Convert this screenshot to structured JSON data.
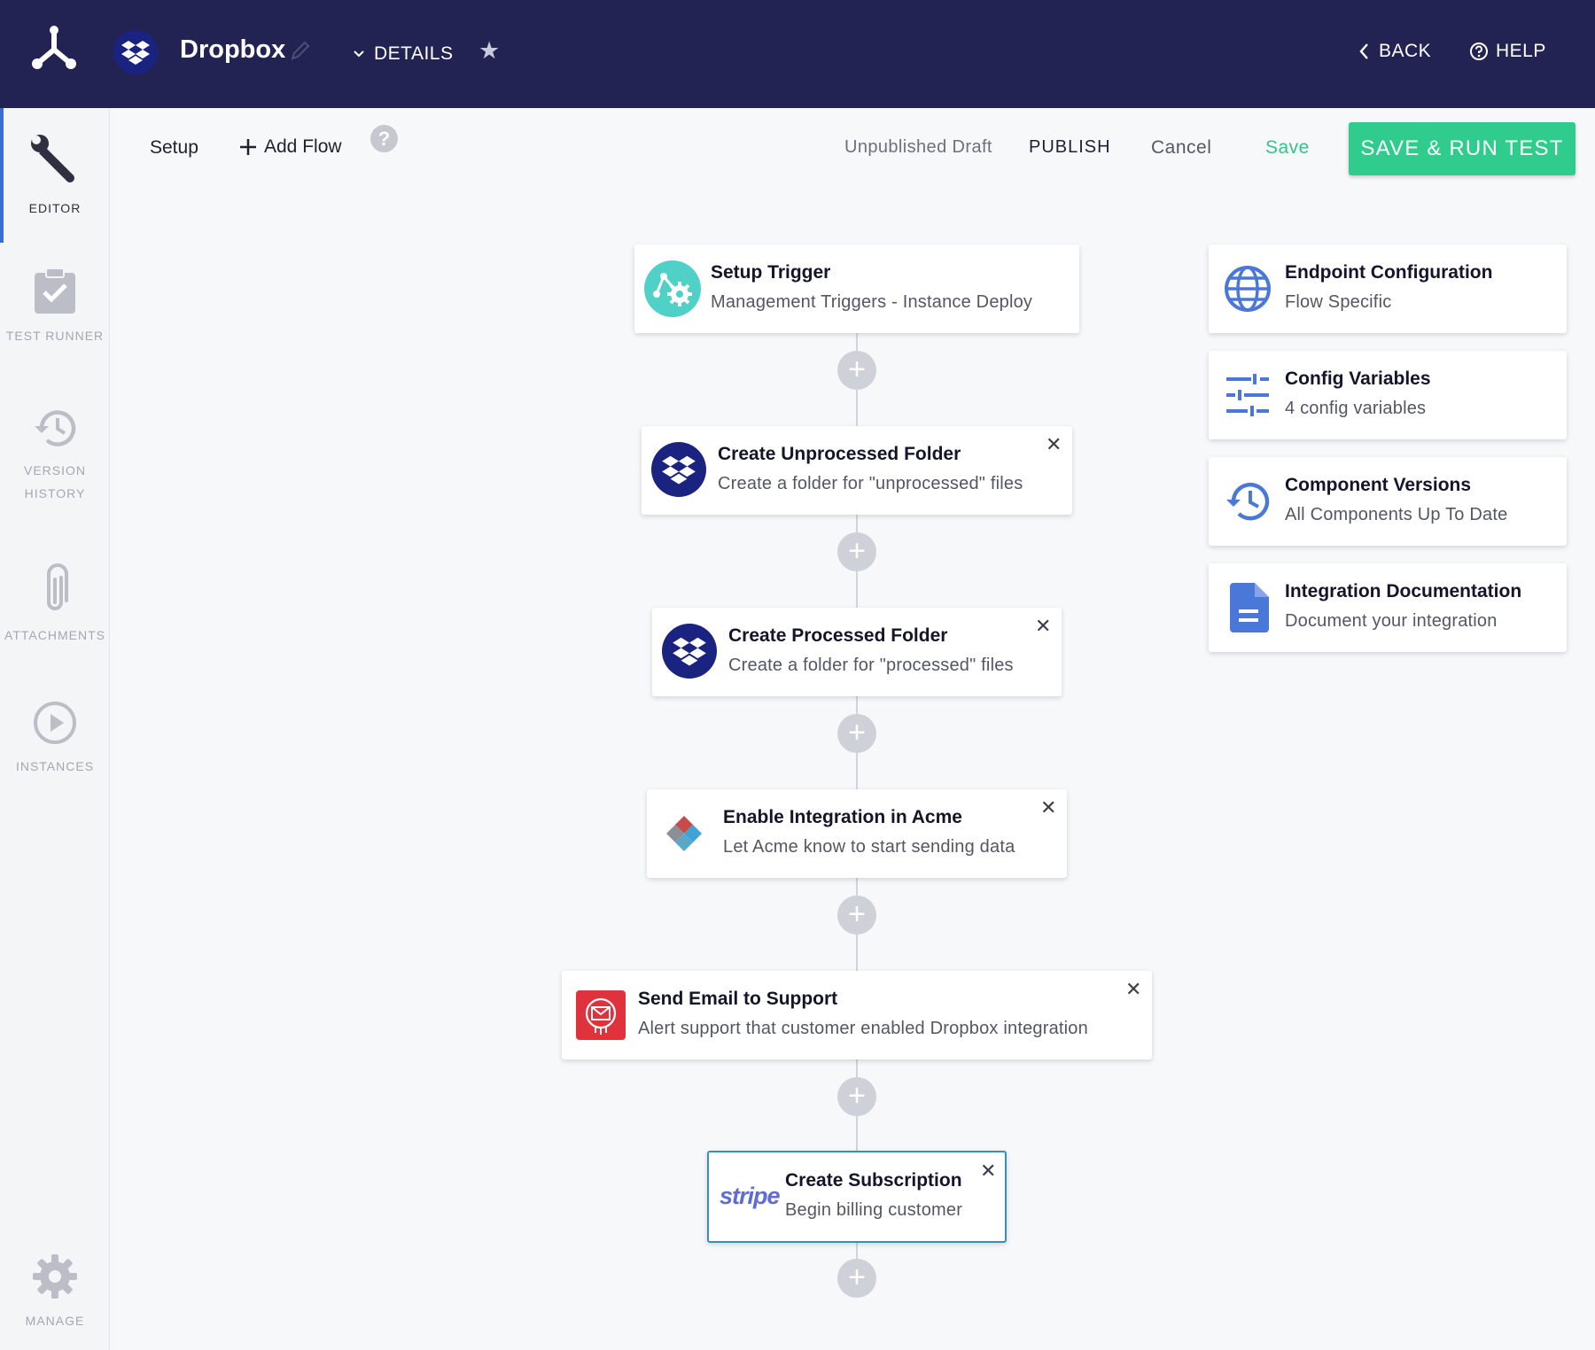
{
  "header": {
    "app_title": "Dropbox",
    "details_label": "DETAILS",
    "back_label": "BACK",
    "help_label": "HELP",
    "colors": {
      "bar": "#222353"
    }
  },
  "sidebar": {
    "items": [
      {
        "label": "EDITOR",
        "icon": "wrench-icon",
        "active": true
      },
      {
        "label": "TEST RUNNER",
        "icon": "clipboard-check-icon"
      },
      {
        "label_line1": "VERSION",
        "label_line2": "HISTORY",
        "icon": "history-icon"
      },
      {
        "label": "ATTACHMENTS",
        "icon": "paperclip-icon"
      },
      {
        "label": "INSTANCES",
        "icon": "play-circle-icon"
      },
      {
        "label": "MANAGE",
        "icon": "gear-icon"
      }
    ]
  },
  "toolbar": {
    "setup_label": "Setup",
    "add_flow_label": "Add Flow",
    "help_glyph": "?",
    "status_text": "Unpublished Draft",
    "publish_label": "PUBLISH",
    "cancel_label": "Cancel",
    "save_label": "Save",
    "save_run_label": "SAVE & RUN TEST"
  },
  "flow": {
    "steps": [
      {
        "title": "Setup Trigger",
        "subtitle": "Management Triggers - Instance Deploy",
        "icon": "trigger-gear-icon",
        "closable": false
      },
      {
        "title": "Create Unprocessed Folder",
        "subtitle": "Create a folder for \"unprocessed\" files",
        "icon": "dropbox-icon",
        "closable": true
      },
      {
        "title": "Create Processed Folder",
        "subtitle": "Create a folder for \"processed\" files",
        "icon": "dropbox-icon",
        "closable": true
      },
      {
        "title": "Enable Integration in Acme",
        "subtitle": "Let Acme know to start sending data",
        "icon": "acme-diamond-icon",
        "closable": true
      },
      {
        "title": "Send Email to Support",
        "subtitle": "Alert support that customer enabled Dropbox integration",
        "icon": "email-icon",
        "closable": true
      },
      {
        "title": "Create Subscription",
        "subtitle": "Begin billing customer",
        "icon": "stripe-icon",
        "icon_text": "stripe",
        "closable": true,
        "selected": true
      }
    ],
    "close_glyph": "✕",
    "add_glyph": "+"
  },
  "config_panel": {
    "items": [
      {
        "title": "Endpoint Configuration",
        "subtitle": "Flow Specific",
        "icon": "globe-icon"
      },
      {
        "title": "Config Variables",
        "subtitle": "4 config variables",
        "icon": "sliders-icon"
      },
      {
        "title": "Component Versions",
        "subtitle": "All Components Up To Date",
        "icon": "history-icon"
      },
      {
        "title": "Integration Documentation",
        "subtitle": "Document your integration",
        "icon": "document-icon"
      }
    ],
    "accent": "#4a78d8"
  }
}
